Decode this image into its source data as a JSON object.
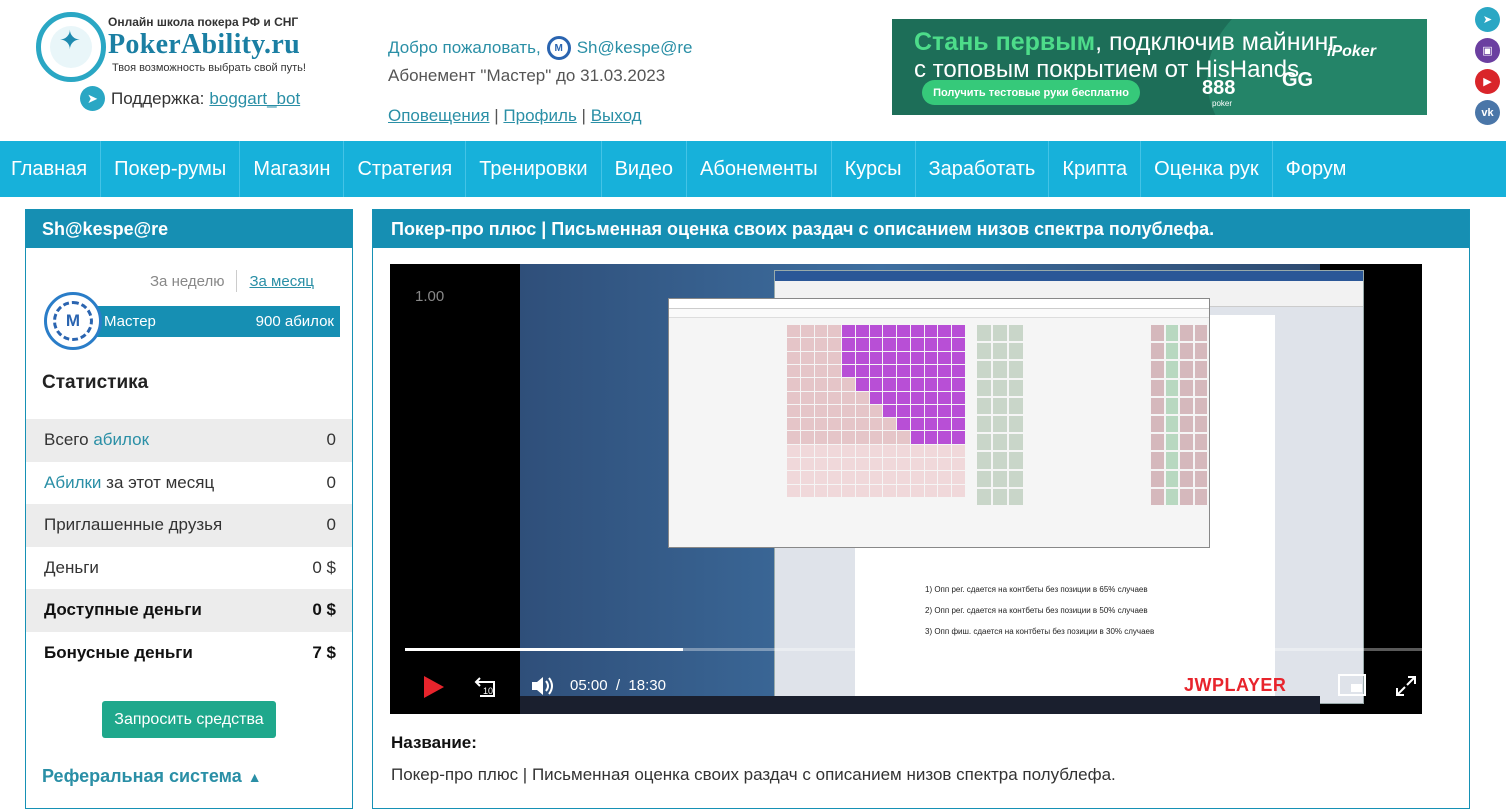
{
  "header": {
    "logo_tagline_top": "Онлайн школа покера РФ и СНГ",
    "logo_name": "PokerAbility.ru",
    "logo_tagline_bottom": "Твоя возможность выбрать свой путь!",
    "support_label": "Поддержка:",
    "support_link": "boggart_bot",
    "welcome_text": "Добро пожаловать,",
    "username": "Sh@kespe@re",
    "avatar_letter": "M",
    "subscription": "Абонемент \"Мастер\" до 31.03.2023",
    "links": {
      "notifications": "Оповещения",
      "profile": "Профиль",
      "logout": "Выход",
      "separator": "|"
    }
  },
  "banner": {
    "line1_bold": "Стань первым",
    "line1_rest": ", подключив майнинг",
    "line2": "с топовым покрытием от HisHands",
    "button": "Получить тестовые руки бесплатно",
    "brand_ipoker": "iPoker",
    "brand_gg": "GG",
    "brand_888": "888",
    "brand_888_sub": "poker"
  },
  "social": [
    {
      "icon": "telegram-icon",
      "color": "#2aa7c4",
      "glyph": "➤"
    },
    {
      "icon": "twitch-icon",
      "color": "#6b3fa0",
      "glyph": "▣"
    },
    {
      "icon": "youtube-icon",
      "color": "#d9252a",
      "glyph": "▶"
    },
    {
      "icon": "vk-icon",
      "color": "#4a76a8",
      "glyph": "vk"
    }
  ],
  "nav": [
    "Главная",
    "Покер-румы",
    "Магазин",
    "Стратегия",
    "Тренировки",
    "Видео",
    "Абонементы",
    "Курсы",
    "Заработать",
    "Крипта",
    "Оценка рук",
    "Форум"
  ],
  "sidebar": {
    "username": "Sh@kespe@re",
    "period_week": "За неделю",
    "period_month": "За месяц",
    "tier_name": "Мастер",
    "tier_points": "900 абилок",
    "tier_letter": "M",
    "stats_title": "Статистика",
    "stats": [
      {
        "label_pre": "Всего ",
        "label_accent": "абилок",
        "label_post": "",
        "value": "0",
        "shade": true,
        "bold": false
      },
      {
        "label_pre": "",
        "label_accent": "Абилки",
        "label_post": " за этот месяц",
        "value": "0",
        "shade": false,
        "bold": false
      },
      {
        "label_pre": "Приглашенные друзья",
        "label_accent": "",
        "label_post": "",
        "value": "0",
        "shade": true,
        "bold": false
      },
      {
        "label_pre": "Деньги",
        "label_accent": "",
        "label_post": "",
        "value": "0 $",
        "shade": false,
        "bold": false
      },
      {
        "label_pre": "Доступные деньги",
        "label_accent": "",
        "label_post": "",
        "value": "0 $",
        "shade": true,
        "bold": true
      },
      {
        "label_pre": "Бонусные деньги",
        "label_accent": "",
        "label_post": "",
        "value": "7 $",
        "shade": false,
        "bold": true
      }
    ],
    "request_button": "Запросить средства",
    "referral": "Реферальная система",
    "referral_chevron": "▲"
  },
  "main": {
    "title": "Покер-про плюс | Письменная оценка своих раздач с описанием низов спектра полублефа.",
    "player": {
      "version": "1.00",
      "current_time": "05:00",
      "time_separator": "/",
      "duration": "18:30",
      "progress": 0.27,
      "brand": "JWPLAYER"
    },
    "doc_lines": [
      "1)   Опп рег. сдается на контбеты без позиции в 65% случаев",
      "2)   Опп рег. сдается на контбеты без позиции в 50% случаев",
      "3)   Опп фиш. сдается на контбеты без позиции в 30% случаев"
    ],
    "name_label": "Название:",
    "name_value": "Покер-про плюс | Письменная оценка своих раздач с описанием низов спектра полублефа."
  }
}
